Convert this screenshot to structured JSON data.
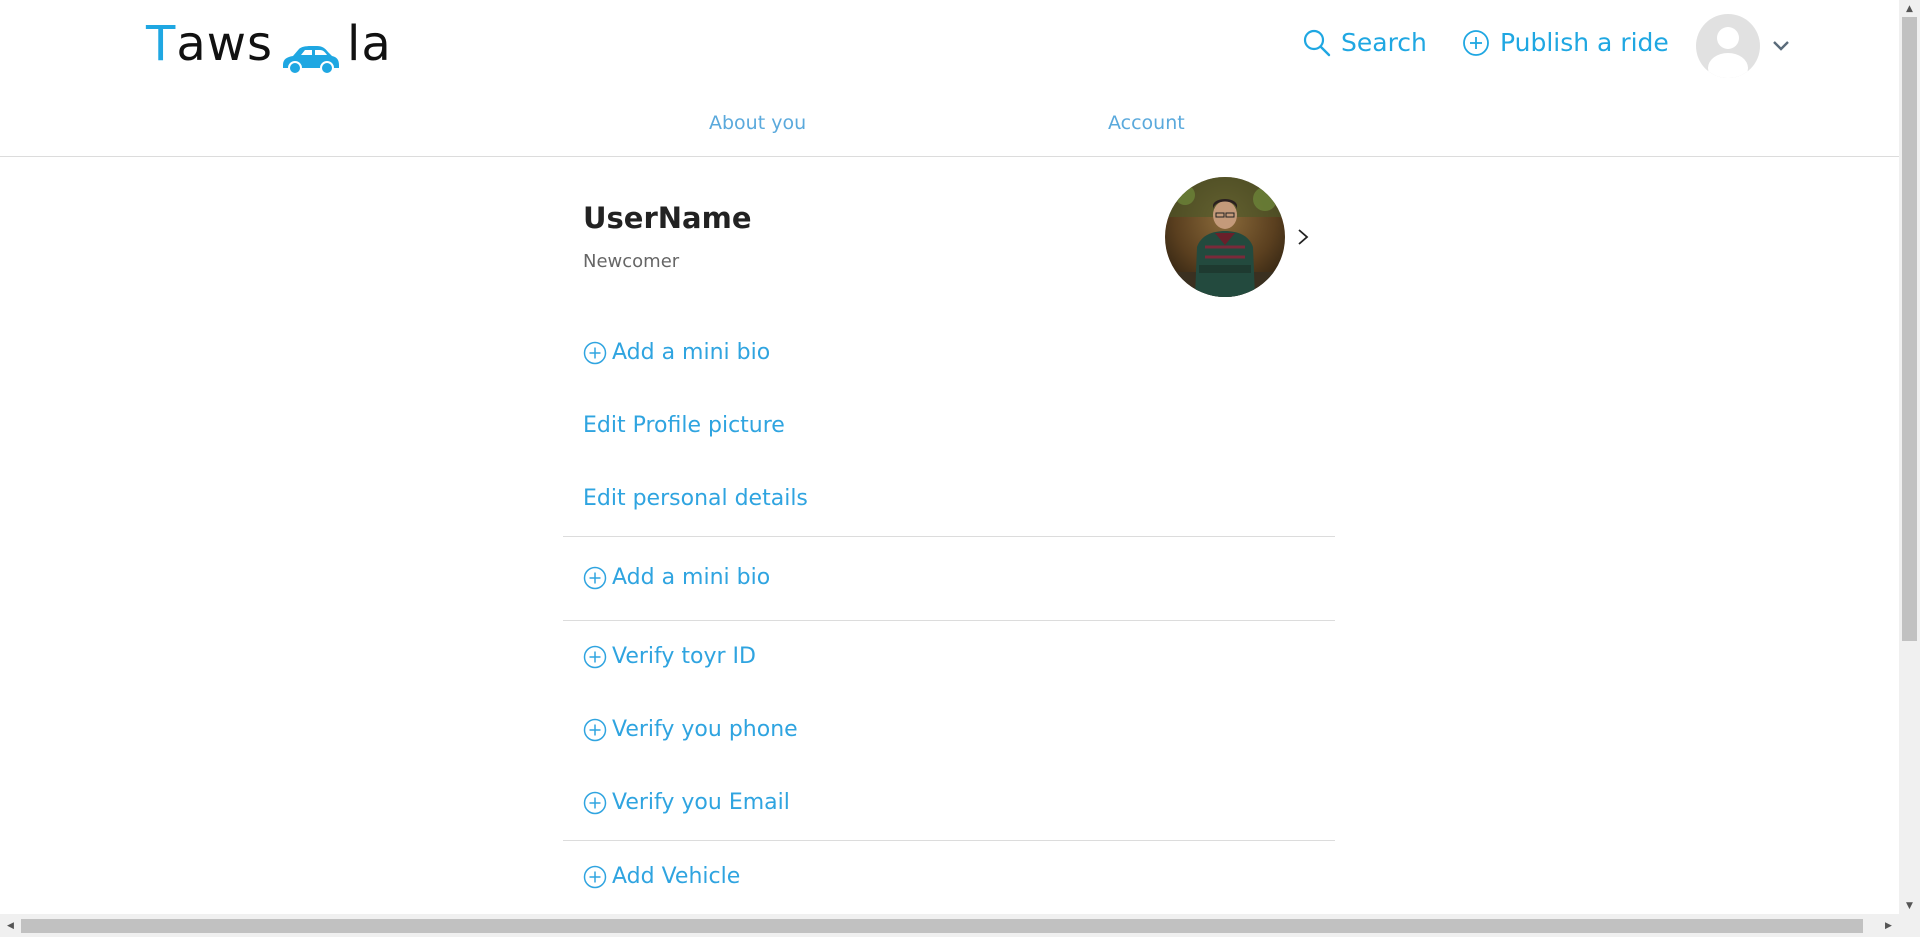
{
  "brand": {
    "logo_prefix": "T",
    "logo_mid": "aws",
    "logo_suffix": "la",
    "accent_color": "#1fa7e2"
  },
  "header": {
    "search_label": "Search",
    "publish_label": "Publish a ride",
    "avatar_icon": "user-avatar-icon",
    "menu_icon": "chevron-down-icon"
  },
  "tabs": [
    {
      "label": "About you"
    },
    {
      "label": "Account"
    }
  ],
  "profile": {
    "username": "UserName",
    "level": "Newcomer"
  },
  "links": {
    "add_bio_1": "Add a mini bio",
    "edit_picture": "Edit Profile picture",
    "edit_details": "Edit personal details",
    "add_bio_2": "Add a mini bio",
    "verify_id": "Verify toyr ID",
    "verify_phone": "Verify you phone",
    "verify_email": "Verify you Email",
    "add_vehicle": "Add Vehicle"
  }
}
